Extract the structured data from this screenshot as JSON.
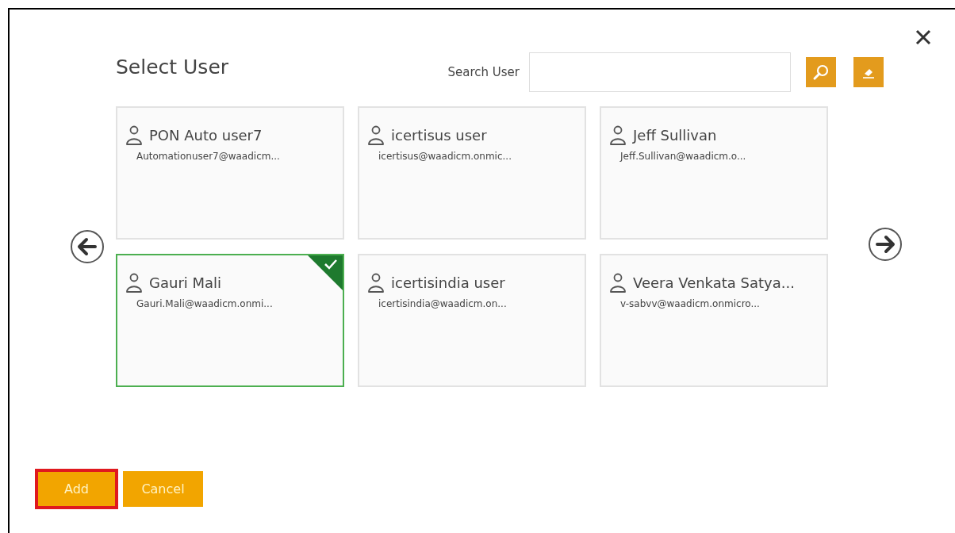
{
  "dialog": {
    "title": "Select User"
  },
  "search": {
    "label": "Search User"
  },
  "users": [
    {
      "name": "PON Auto user7",
      "email": "Automationuser7@waadicm...",
      "selected": false
    },
    {
      "name": "icertisus user",
      "email": "icertisus@waadicm.onmic...",
      "selected": false
    },
    {
      "name": "Jeff Sullivan",
      "email": "Jeff.Sullivan@waadicm.o...",
      "selected": false
    },
    {
      "name": "Gauri Mali",
      "email": "Gauri.Mali@waadicm.onmi...",
      "selected": true
    },
    {
      "name": "icertisindia user",
      "email": "icertisindia@waadicm.on...",
      "selected": false
    },
    {
      "name": "Veera Venkata Satya...",
      "email": "v-sabvv@waadicm.onmicro...",
      "selected": false
    }
  ],
  "buttons": [
    {
      "label": "Add",
      "highlighted": true
    },
    {
      "label": "Cancel",
      "highlighted": false
    }
  ]
}
